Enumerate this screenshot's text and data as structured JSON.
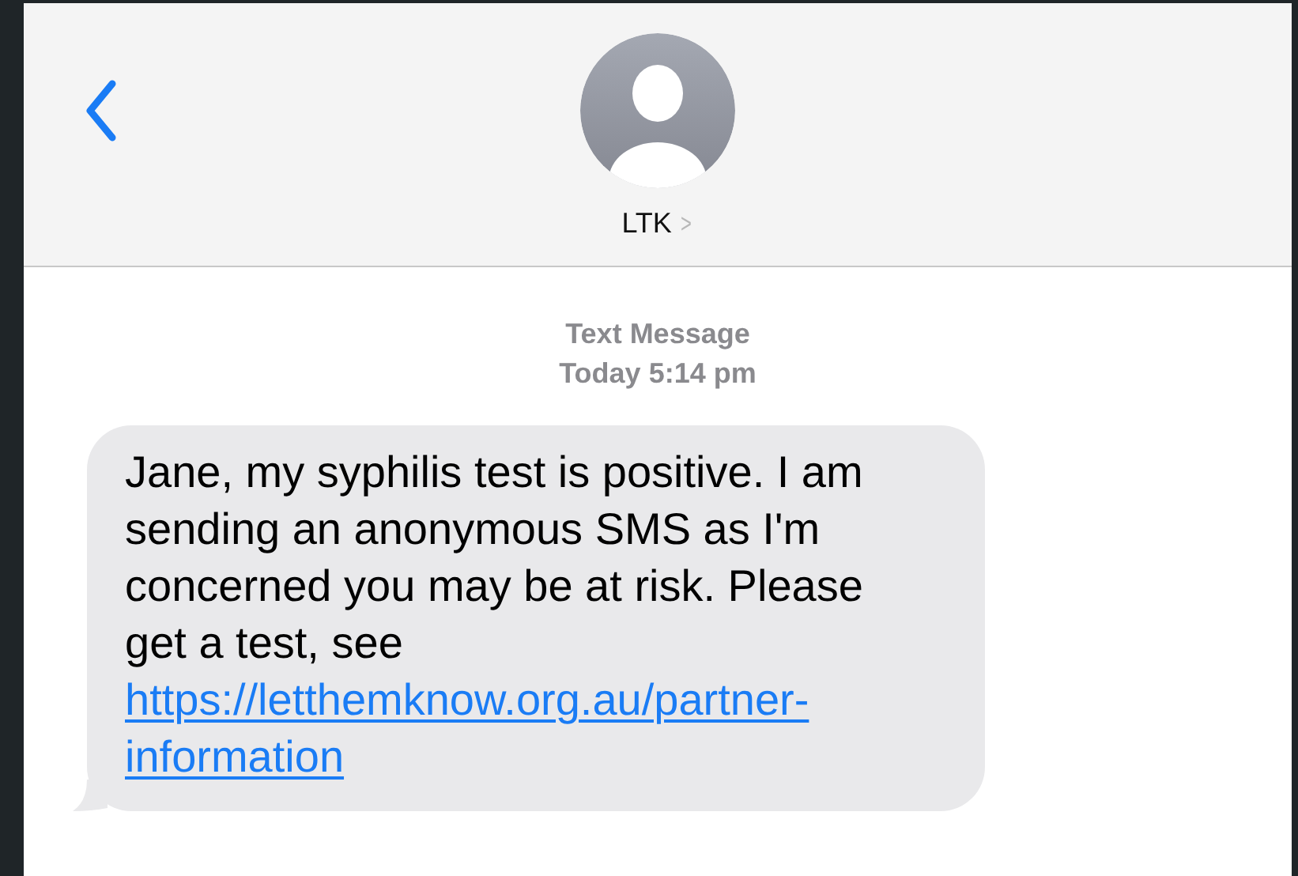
{
  "header": {
    "contact_name": "LTK",
    "chevron": ">"
  },
  "conversation": {
    "service": "Text Message",
    "timestamp": "Today 5:14 pm",
    "messages": [
      {
        "kind": "incoming",
        "text": "Jane, my syphilis test is positive. I am sending an anonymous SMS as I'm concerned you may be at risk. Please get a test, see ",
        "link": "https://letthemknow.org.au/partner-information"
      }
    ]
  }
}
